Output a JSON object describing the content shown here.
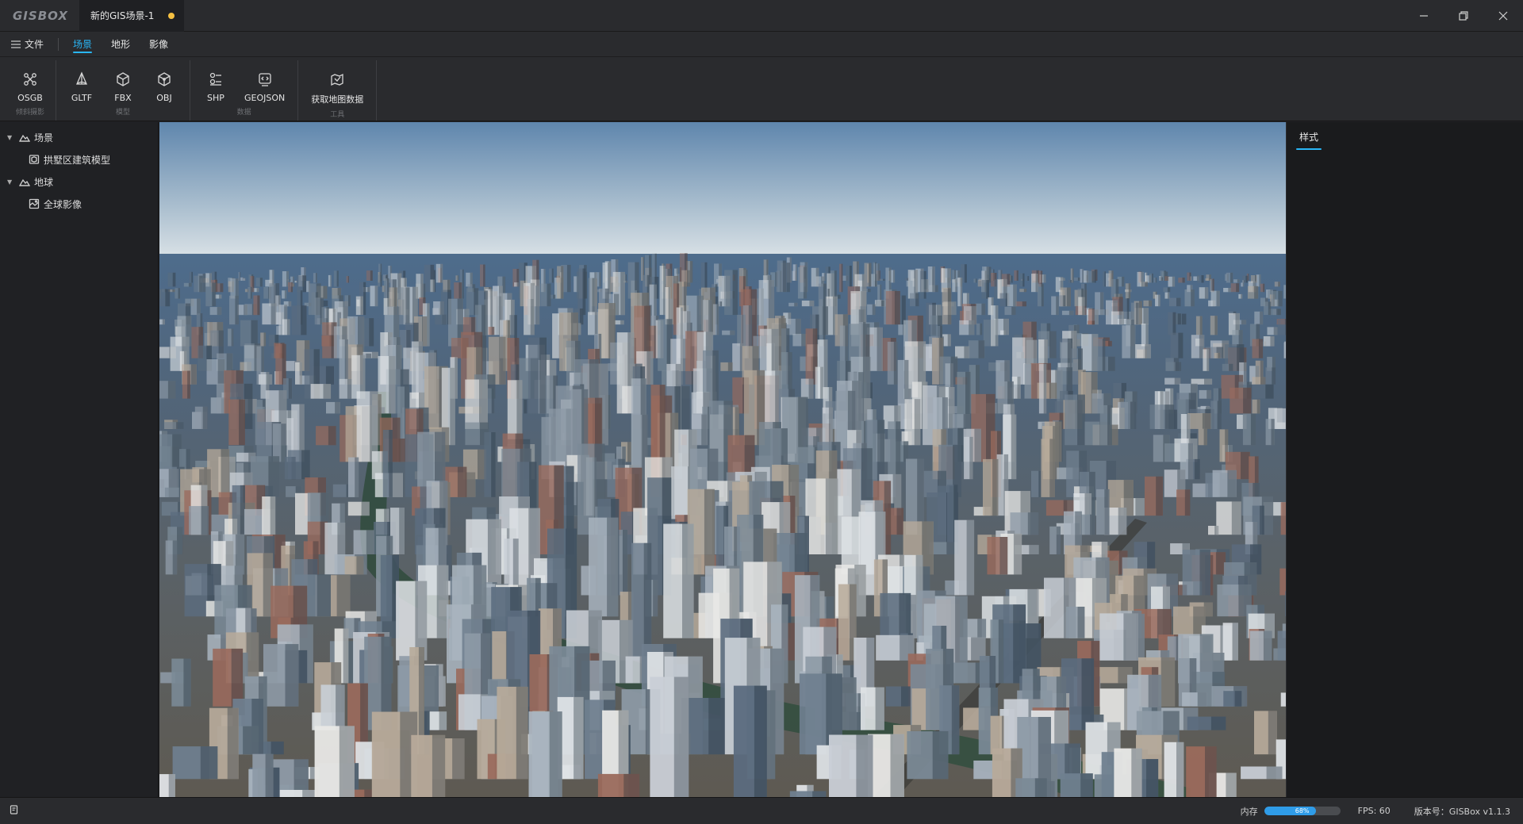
{
  "app": {
    "logo": "GISBOX",
    "document_tab": "新的GIS场景-1"
  },
  "colors": {
    "accent": "#29b6f6",
    "unsaved_dot": "#f5c042",
    "mem_bar": "#2f9ce8"
  },
  "menu": {
    "file": "文件",
    "tabs": [
      {
        "label": "场景",
        "active": true
      },
      {
        "label": "地形",
        "active": false
      },
      {
        "label": "影像",
        "active": false
      }
    ]
  },
  "ribbon": {
    "groups": [
      {
        "label": "倾斜摄影",
        "items": [
          {
            "label": "OSGB",
            "icon": "osgb-icon"
          }
        ]
      },
      {
        "label": "模型",
        "items": [
          {
            "label": "GLTF",
            "icon": "gltf-icon"
          },
          {
            "label": "FBX",
            "icon": "fbx-icon"
          },
          {
            "label": "OBJ",
            "icon": "obj-icon"
          }
        ]
      },
      {
        "label": "数据",
        "items": [
          {
            "label": "SHP",
            "icon": "shp-icon"
          },
          {
            "label": "GEOJSON",
            "icon": "geojson-icon"
          }
        ]
      },
      {
        "label": "工具",
        "items": [
          {
            "label": "获取地图数据",
            "icon": "fetch-map-data-icon"
          }
        ]
      }
    ]
  },
  "tree": {
    "scene": {
      "label": "场景",
      "children": [
        {
          "label": "拱墅区建筑模型"
        }
      ]
    },
    "globe": {
      "label": "地球",
      "children": [
        {
          "label": "全球影像"
        }
      ]
    }
  },
  "right_panel": {
    "tab": "样式"
  },
  "status": {
    "memory_label": "内存",
    "memory_percent": 68,
    "memory_text": "68%",
    "fps": "FPS: 60",
    "version": "版本号：GISBox v1.1.3"
  }
}
